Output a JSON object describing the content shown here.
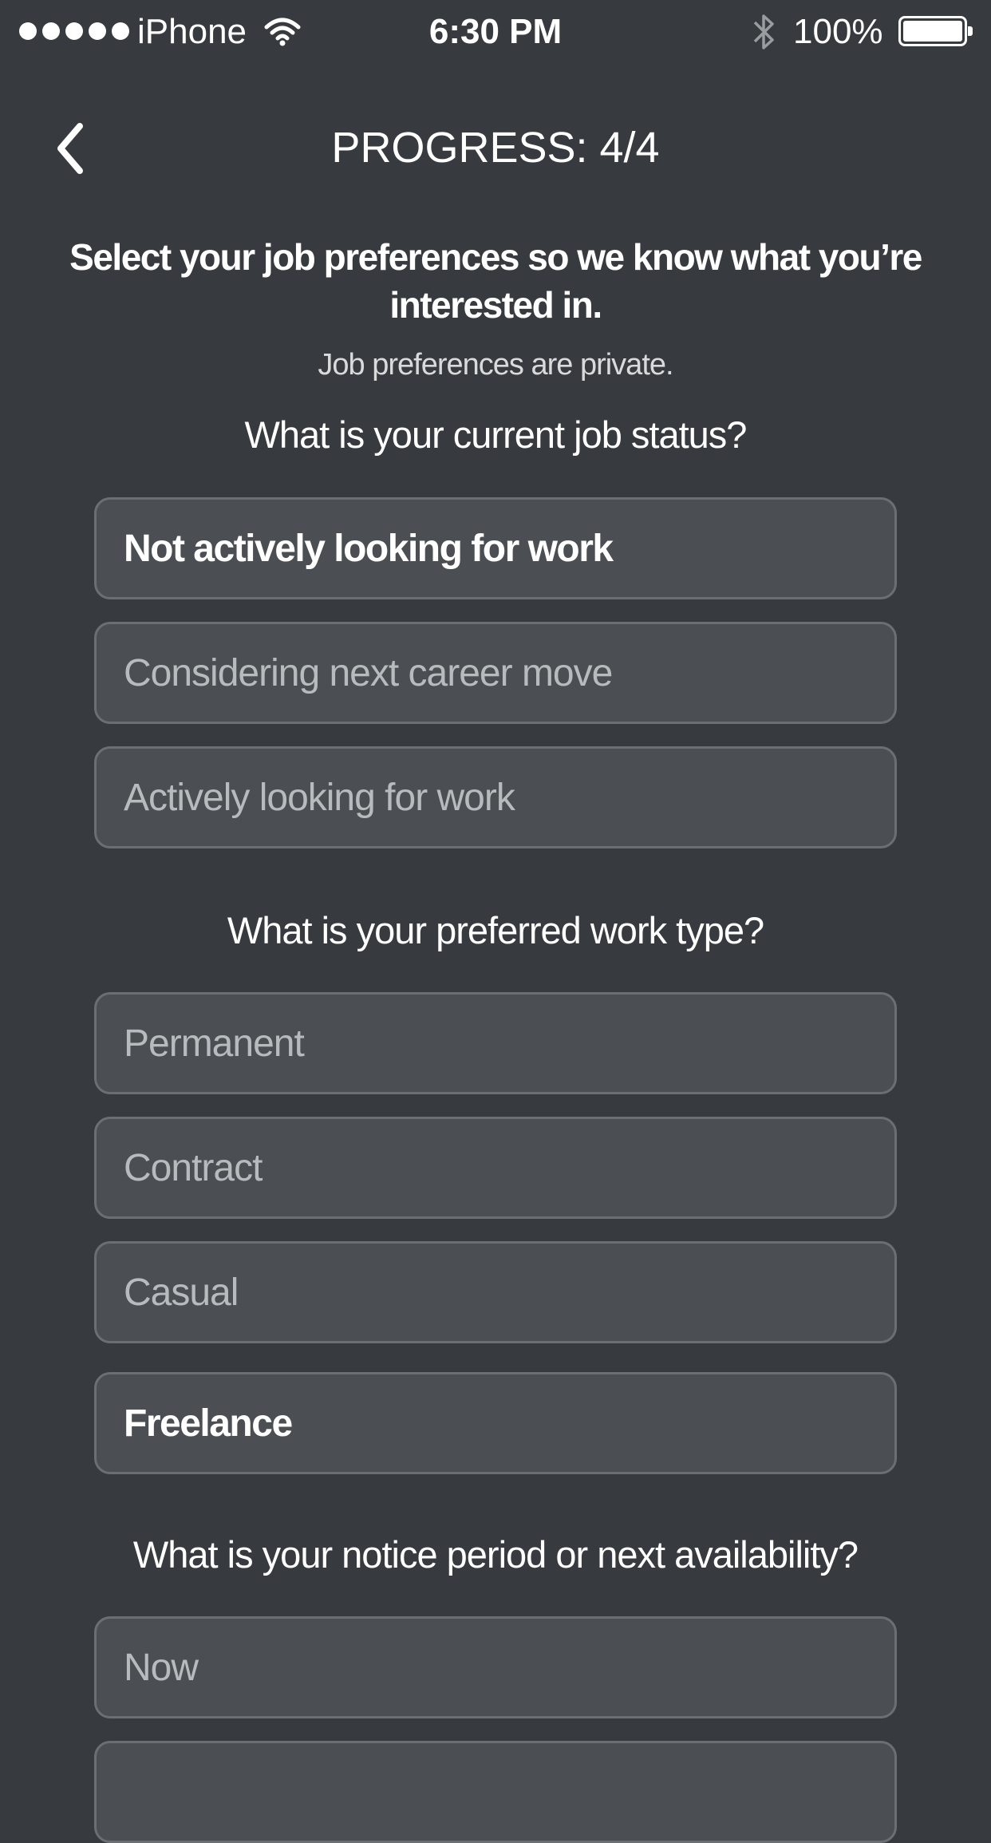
{
  "status_bar": {
    "carrier": "iPhone",
    "time": "6:30 PM",
    "battery": "100%",
    "icons": [
      "signal-dots-icon",
      "wifi-icon",
      "bluetooth-icon",
      "battery-icon"
    ]
  },
  "header": {
    "title": "PROGRESS: 4/4",
    "back_icon": "chevron-left-icon"
  },
  "intro": {
    "heading": "Select your job preferences so we know what you’re interested in.",
    "subtext": "Job preferences are private."
  },
  "sections": [
    {
      "question": "What is your current job status?",
      "options": [
        {
          "label": "Not actively looking for work",
          "selected": true
        },
        {
          "label": "Considering next career move",
          "selected": false
        },
        {
          "label": "Actively looking for work",
          "selected": false
        }
      ]
    },
    {
      "question": "What is your preferred work type?",
      "options": [
        {
          "label": "Permanent",
          "selected": false
        },
        {
          "label": "Contract",
          "selected": false
        },
        {
          "label": "Casual",
          "selected": false
        },
        {
          "label": "Freelance",
          "selected": true
        }
      ]
    },
    {
      "question": "What is your notice period or next availability?",
      "options": [
        {
          "label": "Now",
          "selected": false
        },
        {
          "label": "",
          "selected": false
        }
      ]
    }
  ],
  "colors": {
    "background": "#373a3e",
    "option_background": "#4b4f53",
    "option_border": "#6b6f74",
    "option_text": "#b8bbbe",
    "selected_text": "#ffffff"
  }
}
